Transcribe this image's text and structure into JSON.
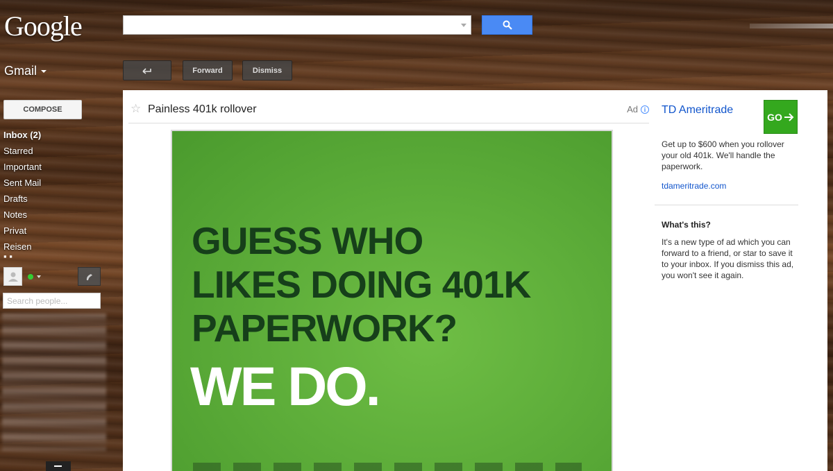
{
  "header": {
    "logo": "Google",
    "search_value": "",
    "gmail_label": "Gmail"
  },
  "toolbar": {
    "forward_label": "Forward",
    "dismiss_label": "Dismiss"
  },
  "sidebar": {
    "compose_label": "COMPOSE",
    "items": [
      {
        "label": "Inbox (2)",
        "bold": true
      },
      {
        "label": "Starred"
      },
      {
        "label": "Important"
      },
      {
        "label": "Sent Mail"
      },
      {
        "label": "Drafts"
      },
      {
        "label": "Notes"
      },
      {
        "label": "Privat"
      },
      {
        "label": "Reisen"
      }
    ],
    "people_search_placeholder": "Search people..."
  },
  "message": {
    "subject": "Painless 401k rollover",
    "ad_label": "Ad",
    "ad_image": {
      "headline_lines": [
        "GUESS WHO",
        "LIKES DOING 401K",
        "PAPERWORK?"
      ],
      "tagline": "WE DO."
    }
  },
  "ad_sidebar": {
    "advertiser": "TD Ameritrade",
    "go_label": "GO",
    "description": "Get up to $600 when you rollover your old 401k. We'll handle the paperwork.",
    "url": "tdameritrade.com",
    "whats_this_title": "What's this?",
    "whats_this_text": "It's a new type of ad which you can forward to a friend, or star to save it to your inbox. If you dismiss this ad, you won't see it again."
  },
  "colors": {
    "accent_blue": "#4a8af4",
    "link_blue": "#1155cc",
    "ad_green": "#5eae3a",
    "go_green": "#34a81e",
    "headline_dark_green": "#163f1a"
  }
}
